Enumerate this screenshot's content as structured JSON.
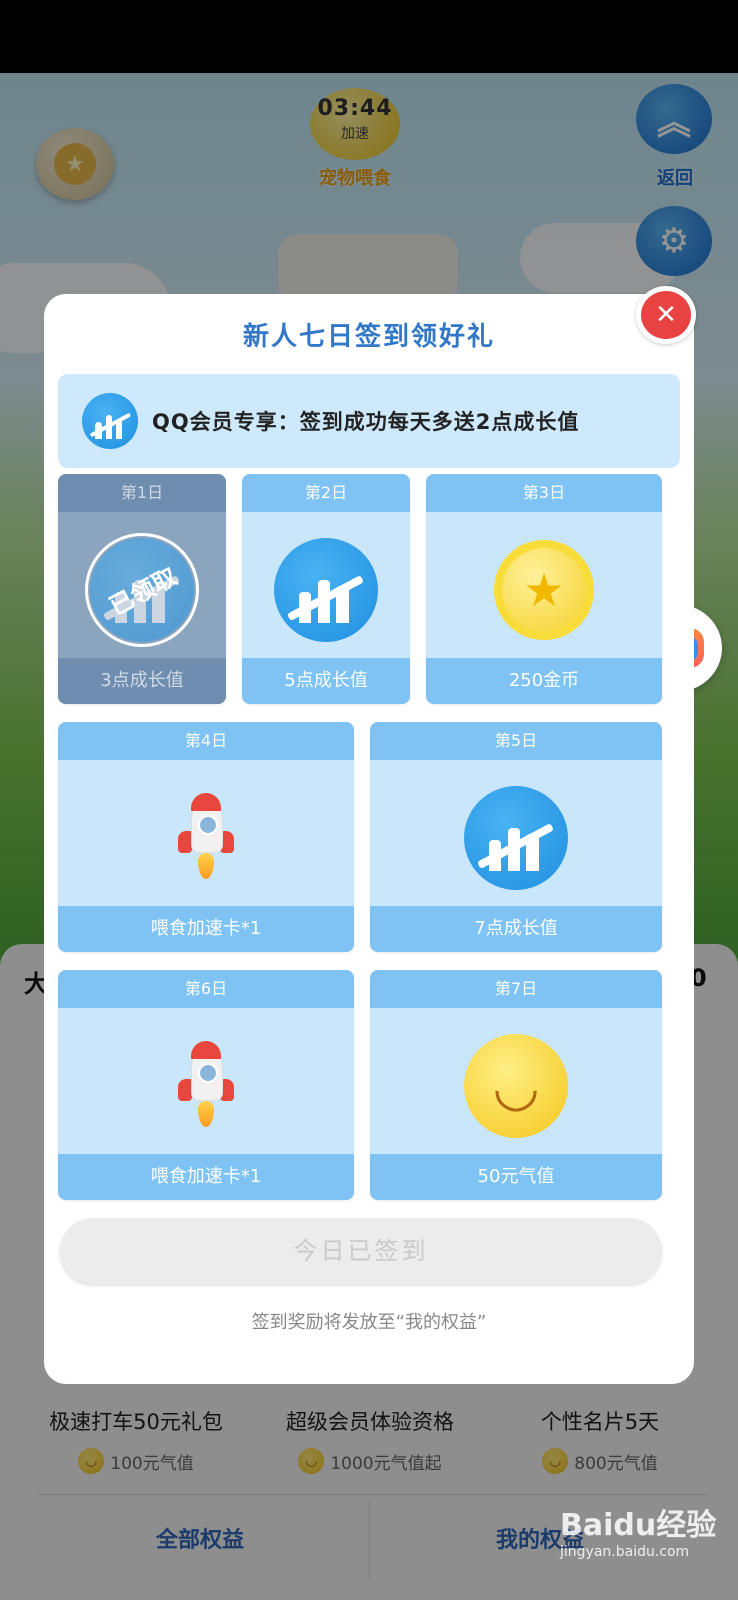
{
  "game": {
    "timer": "03:44",
    "speed_label": "加速",
    "feed_label": "宠物喂食",
    "back_label": "返回",
    "back_icon": "double-chevron-up",
    "settings_icon": "gear",
    "trophy_icon": "star-medal"
  },
  "rights_panel": {
    "title_left": "大",
    "title_right": "0",
    "items": [
      {
        "name": "极速打车50元礼包",
        "cost": "100元气值"
      },
      {
        "name": "超级会员体验资格",
        "cost": "1000元气值起"
      },
      {
        "name": "个性名片5天",
        "cost": "800元气值"
      }
    ],
    "nav": {
      "all": "全部权益",
      "mine": "我的权益"
    }
  },
  "modal": {
    "title": "新人七日签到领好礼",
    "banner": "QQ会员专享：签到成功每天多送2点成长值",
    "days": [
      {
        "label": "第1日",
        "reward": "3点成长值",
        "icon": "growth-chart",
        "claimed": true,
        "stamp": "已领取"
      },
      {
        "label": "第2日",
        "reward": "5点成长值",
        "icon": "growth-chart",
        "claimed": false
      },
      {
        "label": "第3日",
        "reward": "250金币",
        "icon": "gold-coin",
        "claimed": false
      },
      {
        "label": "第4日",
        "reward": "喂食加速卡*1",
        "icon": "rocket",
        "claimed": false
      },
      {
        "label": "第5日",
        "reward": "7点成长值",
        "icon": "growth-chart",
        "claimed": false
      },
      {
        "label": "第6日",
        "reward": "喂食加速卡*1",
        "icon": "rocket",
        "claimed": false
      },
      {
        "label": "第7日",
        "reward": "50元气值",
        "icon": "smile-face",
        "claimed": false
      }
    ],
    "signed_button": "今日已签到",
    "footer_note": "签到奖励将发放至“我的权益”"
  },
  "watermark": {
    "logo": "Baidu经验",
    "url": "jingyan.baidu.com"
  },
  "colors": {
    "accent": "#3378c8",
    "card_bg": "#c9e6fb",
    "card_head": "#7ec3f4",
    "close": "#e84242"
  }
}
